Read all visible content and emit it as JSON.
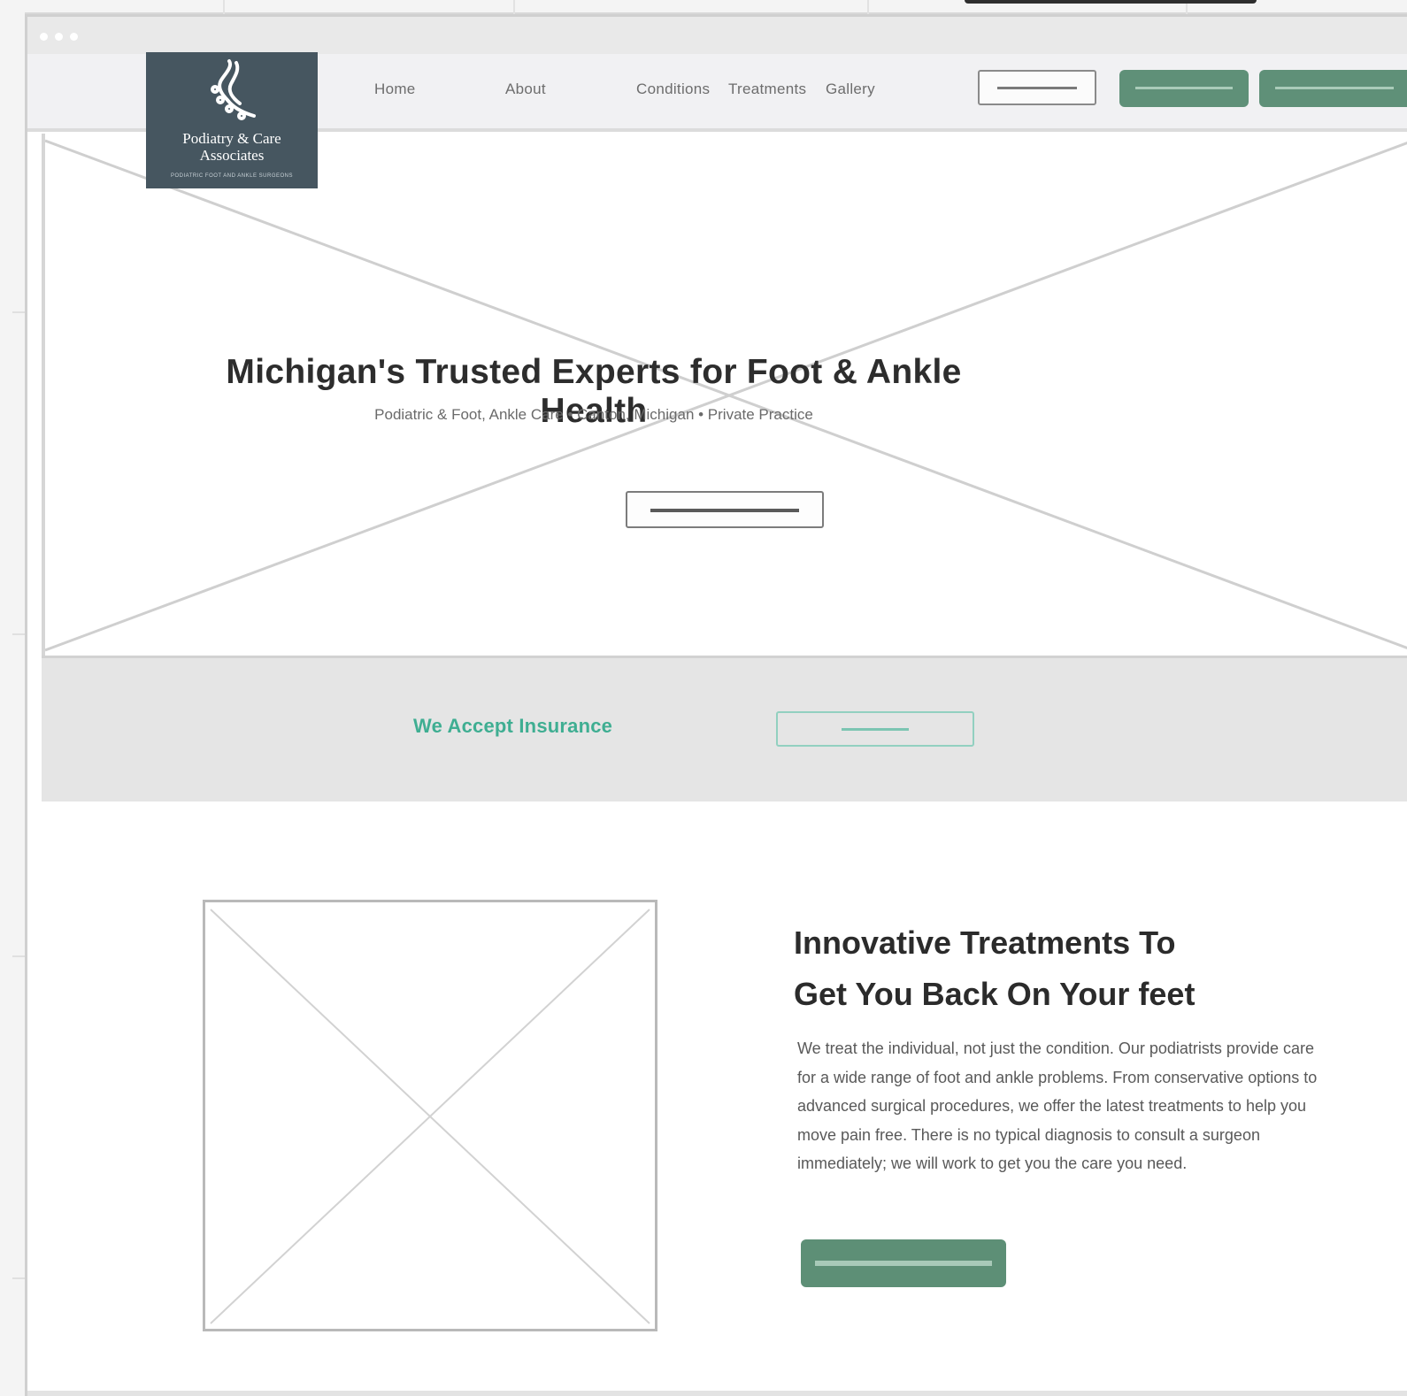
{
  "nav": {
    "links": [
      "Home",
      "About",
      "Conditions",
      "Treatments",
      "Gallery"
    ]
  },
  "logo": {
    "line1": "Podiatry & Care",
    "line2": "Associates",
    "tagline": "PODIATRIC FOOT AND ANKLE SURGEONS"
  },
  "hero": {
    "title": "Michigan's Trusted Experts for Foot & Ankle Health",
    "subtitle": "Podiatric & Foot, Ankle Care • Canton, Michigan • Private Practice"
  },
  "insurance": {
    "text": "We Accept Insurance"
  },
  "feature": {
    "title_line1": "Innovative Treatments To",
    "title_line2": "Get You Back On Your feet",
    "body": "We treat the individual, not just the condition. Our podiatrists provide care for a wide range of foot and ankle problems. From conservative options to advanced surgical procedures, we offer the latest treatments to help you move pain free. There is no typical diagnosis to consult a surgeon immediately; we will work to get you the care you need."
  },
  "colors": {
    "brand_green": "#5f9078",
    "accent_teal": "#3fae92",
    "logo_bg": "#465660"
  }
}
